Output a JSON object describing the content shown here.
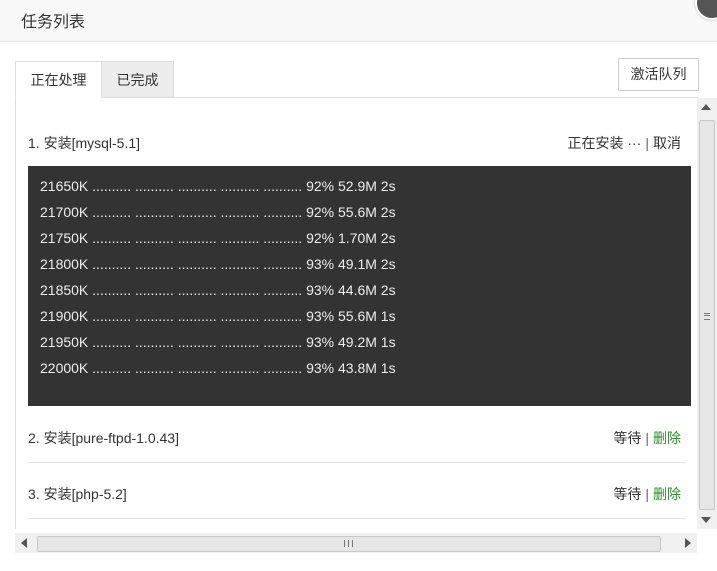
{
  "header": {
    "title": "任务列表"
  },
  "tabs": [
    {
      "label": "正在处理",
      "active": true
    },
    {
      "label": "已完成",
      "active": false
    }
  ],
  "toolbar": {
    "activate_label": "激活队列"
  },
  "tasks": [
    {
      "title": "1. 安装[mysql-5.1]",
      "status": "正在安装 ···",
      "separator": "|",
      "action": "取消",
      "console": [
        "21650K .......... .......... .......... .......... .......... 92% 52.9M 2s",
        "21700K .......... .......... .......... .......... .......... 92% 55.6M 2s",
        "21750K .......... .......... .......... .......... .......... 92% 1.70M 2s",
        "21800K .......... .......... .......... .......... .......... 93% 49.1M 2s",
        "21850K .......... .......... .......... .......... .......... 93% 44.6M 2s",
        "21900K .......... .......... .......... .......... .......... 93% 55.6M 1s",
        "21950K .......... .......... .......... .......... .......... 93% 49.2M 1s",
        "22000K .......... .......... .......... .......... .......... 93% 43.8M 1s"
      ]
    },
    {
      "title": "2. 安装[pure-ftpd-1.0.43]",
      "status": "等待",
      "separator": "|",
      "action": "删除"
    },
    {
      "title": "3. 安装[php-5.2]",
      "status": "等待",
      "separator": "|",
      "action": "删除"
    }
  ],
  "colors": {
    "console_bg": "#333333",
    "delete_link": "#2e8b2e"
  }
}
